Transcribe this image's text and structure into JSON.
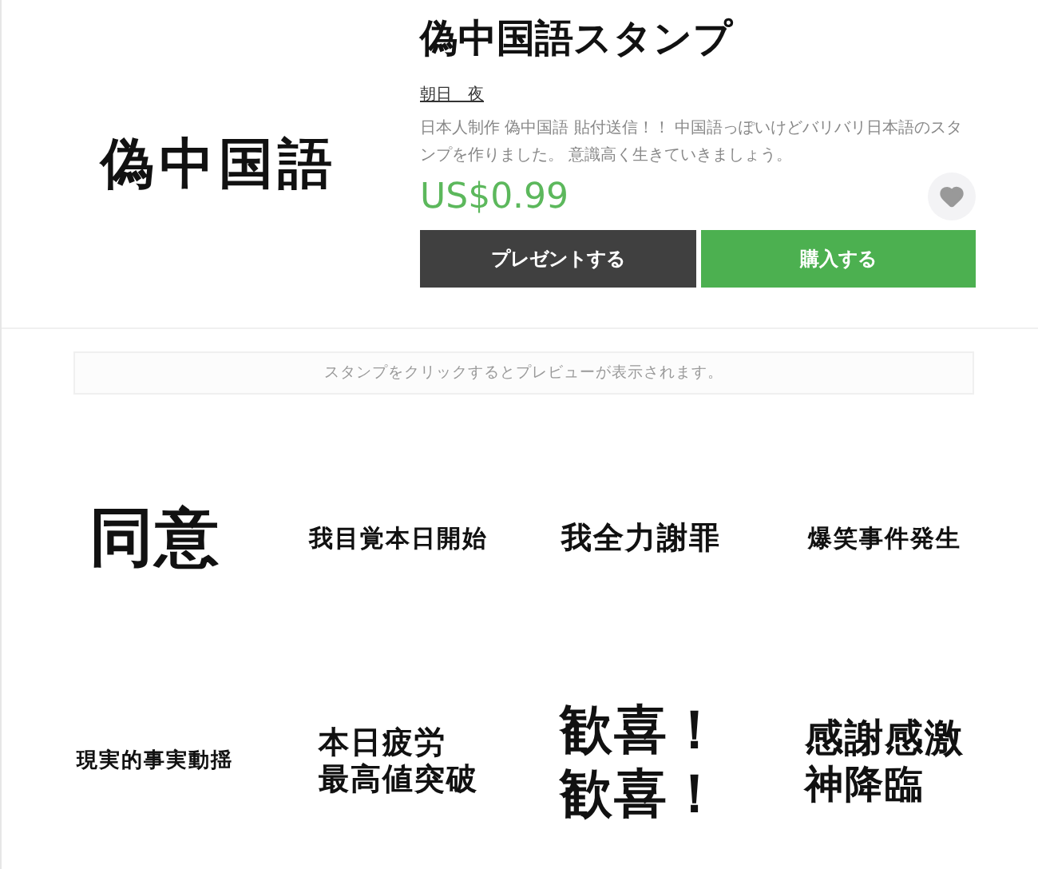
{
  "thumbnail": {
    "text": "偽中国語"
  },
  "product": {
    "title": "偽中国語スタンプ",
    "author": "朝日　夜",
    "description": "日本人制作 偽中国語 貼付送信！！ 中国語っぽいけどバリバリ日本語のスタンプを作りました。 意識高く生きていきましょう。",
    "price": "US$0.99",
    "favorited": false
  },
  "buttons": [
    {
      "label": "プレゼントする",
      "kind": "dark"
    },
    {
      "label": "購入する",
      "kind": "green"
    }
  ],
  "notice": "スタンプをクリックするとプレビューが表示されます。",
  "stamps": [
    {
      "lines": [
        "同意"
      ],
      "kind": "xl"
    },
    {
      "lines": [
        "我目覚本日開始"
      ],
      "kind": "s"
    },
    {
      "lines": [
        "我全力謝罪"
      ],
      "kind": "m"
    },
    {
      "lines": [
        "爆笑事件発生"
      ],
      "kind": "s"
    },
    {
      "lines": [
        "現実的事実動揺"
      ],
      "kind": "xs"
    },
    {
      "lines": [
        "本日疲労",
        "最高値突破"
      ],
      "kind": "m"
    },
    {
      "lines": [
        "歓喜！",
        "歓喜！"
      ],
      "kind": "l"
    },
    {
      "lines": [
        "感謝感激",
        "神降臨"
      ],
      "kind": "ml"
    }
  ]
}
